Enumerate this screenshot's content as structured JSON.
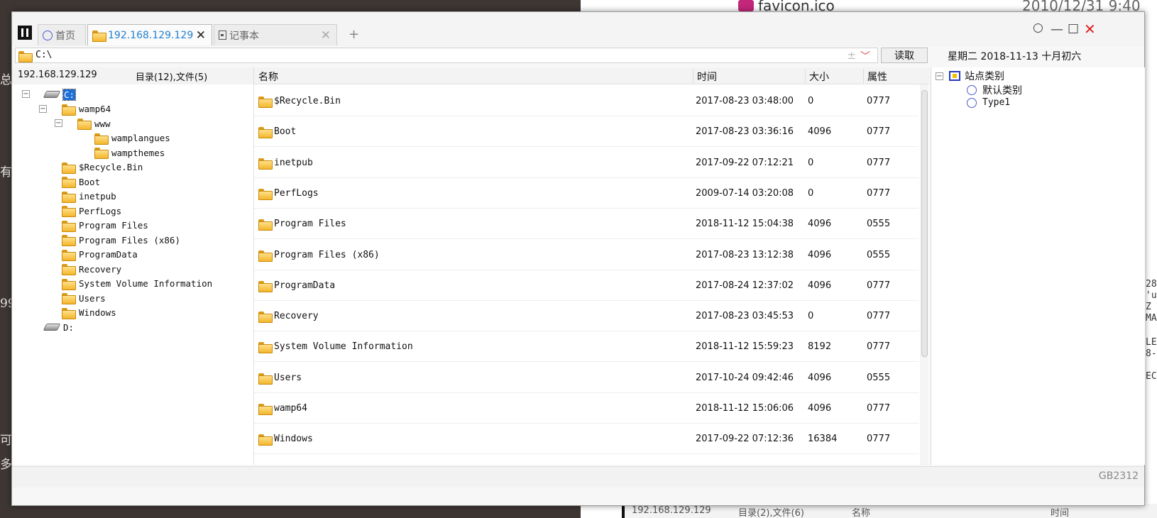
{
  "background": {
    "left_fragments": [
      "总",
      "有",
      "99",
      "可",
      "多"
    ],
    "top_file_name": "favicon.ico",
    "top_file_date": "2010/12/31 9:40",
    "right_fragments": [
      "28",
      "'u",
      "Z",
      "MA",
      "LE",
      "8-",
      "EC"
    ],
    "bottom_status": {
      "host": "192.168.129.129",
      "counts": "目录(2),文件(6)",
      "name": "名称",
      "time": "时间"
    }
  },
  "tabs": [
    {
      "label": "首页",
      "icon": "globe-icon",
      "active": false
    },
    {
      "label": "192.168.129.129",
      "icon": "folder-icon",
      "active": true
    },
    {
      "label": "记事本",
      "icon": "document-icon",
      "active": false
    }
  ],
  "path": {
    "value": "C:\\",
    "read_button": "读取"
  },
  "date_text": "星期二 2018-11-13 十月初六",
  "left_panel": {
    "host": "192.168.129.129",
    "counts": "目录(12),文件(5)",
    "tree": [
      {
        "label": "C:",
        "type": "drive",
        "level": 0,
        "toggle": "⊟",
        "selected": true
      },
      {
        "label": "wamp64",
        "type": "folder",
        "level": 1,
        "toggle": "⊟"
      },
      {
        "label": "www",
        "type": "folder",
        "level": 2,
        "toggle": "⊟"
      },
      {
        "label": "wamplangues",
        "type": "folder",
        "level": 3
      },
      {
        "label": "wampthemes",
        "type": "folder",
        "level": 3
      },
      {
        "label": "$Recycle.Bin",
        "type": "folder",
        "level": 1
      },
      {
        "label": "Boot",
        "type": "folder",
        "level": 1
      },
      {
        "label": "inetpub",
        "type": "folder",
        "level": 1
      },
      {
        "label": "PerfLogs",
        "type": "folder",
        "level": 1
      },
      {
        "label": "Program Files",
        "type": "folder",
        "level": 1
      },
      {
        "label": "Program Files (x86)",
        "type": "folder",
        "level": 1
      },
      {
        "label": "ProgramData",
        "type": "folder",
        "level": 1
      },
      {
        "label": "Recovery",
        "type": "folder",
        "level": 1
      },
      {
        "label": "System Volume Information",
        "type": "folder",
        "level": 1
      },
      {
        "label": "Users",
        "type": "folder",
        "level": 1
      },
      {
        "label": "Windows",
        "type": "folder",
        "level": 1
      },
      {
        "label": "D:",
        "type": "drive",
        "level": 0
      }
    ]
  },
  "file_list": {
    "columns": {
      "name": "名称",
      "time": "时间",
      "size": "大小",
      "attr": "属性"
    },
    "rows": [
      {
        "name": "$Recycle.Bin",
        "time": "2017-08-23 03:48:00",
        "size": "0",
        "attr": "0777"
      },
      {
        "name": "Boot",
        "time": "2017-08-23 03:36:16",
        "size": "4096",
        "attr": "0777"
      },
      {
        "name": "inetpub",
        "time": "2017-09-22 07:12:21",
        "size": "0",
        "attr": "0777"
      },
      {
        "name": "PerfLogs",
        "time": "2009-07-14 03:20:08",
        "size": "0",
        "attr": "0777"
      },
      {
        "name": "Program Files",
        "time": "2018-11-12 15:04:38",
        "size": "4096",
        "attr": "0555"
      },
      {
        "name": "Program Files (x86)",
        "time": "2017-08-23 13:12:38",
        "size": "4096",
        "attr": "0555"
      },
      {
        "name": "ProgramData",
        "time": "2017-08-24 12:37:02",
        "size": "4096",
        "attr": "0777"
      },
      {
        "name": "Recovery",
        "time": "2017-08-23 03:45:53",
        "size": "0",
        "attr": "0777"
      },
      {
        "name": "System Volume Information",
        "time": "2018-11-12 15:59:23",
        "size": "8192",
        "attr": "0777"
      },
      {
        "name": "Users",
        "time": "2017-10-24 09:42:46",
        "size": "4096",
        "attr": "0555"
      },
      {
        "name": "wamp64",
        "time": "2018-11-12 15:06:06",
        "size": "4096",
        "attr": "0777"
      },
      {
        "name": "Windows",
        "time": "2017-09-22 07:12:36",
        "size": "16384",
        "attr": "0777"
      }
    ]
  },
  "right_panel": {
    "root": "站点类别",
    "children": [
      "默认类别",
      "Type1"
    ]
  },
  "status": {
    "encoding": "GB2312"
  },
  "colors": {
    "accent_tab": "#1f7fd0",
    "close_red": "#e02020",
    "folder": "#f3b62c",
    "selection": "#1d6fd6"
  }
}
